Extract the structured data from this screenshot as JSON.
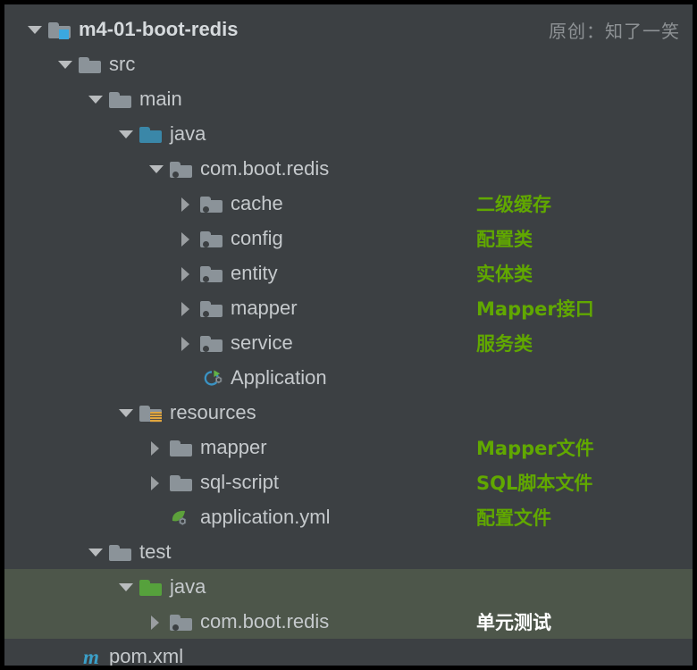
{
  "colors": {
    "background": "#3c4043",
    "frame": "#000000",
    "highlight_row": "#4d564a",
    "label_text": "#c5c9cc",
    "annotation_green": "#61a800",
    "annotation_white": "#ffffff",
    "watermark_text": "#8d9194",
    "folder_grey": "#8b9399",
    "folder_blue": "#3a87a8",
    "folder_green": "#56a13c",
    "module_badge_blue": "#3ba8e0",
    "resources_badge_orange": "#d79b3a",
    "maven_blue": "#3ba0c9"
  },
  "watermark": "原创：知了一笑",
  "tree": {
    "rows": [
      {
        "label": "m4-01-boot-redis",
        "indent": 0,
        "arrow": "down",
        "icon": "module-folder-icon",
        "bold": true,
        "highlight": false,
        "note": ""
      },
      {
        "label": "src",
        "indent": 1,
        "arrow": "down",
        "icon": "folder-icon",
        "bold": false,
        "highlight": false,
        "note": ""
      },
      {
        "label": "main",
        "indent": 2,
        "arrow": "down",
        "icon": "folder-icon",
        "bold": false,
        "highlight": false,
        "note": ""
      },
      {
        "label": "java",
        "indent": 3,
        "arrow": "down",
        "icon": "source-folder-icon",
        "bold": false,
        "highlight": false,
        "note": ""
      },
      {
        "label": "com.boot.redis",
        "indent": 4,
        "arrow": "down",
        "icon": "package-icon",
        "bold": false,
        "highlight": false,
        "note": ""
      },
      {
        "label": "cache",
        "indent": 5,
        "arrow": "right",
        "icon": "package-icon",
        "bold": false,
        "highlight": false,
        "note": "二级缓存"
      },
      {
        "label": "config",
        "indent": 5,
        "arrow": "right",
        "icon": "package-icon",
        "bold": false,
        "highlight": false,
        "note": "配置类"
      },
      {
        "label": "entity",
        "indent": 5,
        "arrow": "right",
        "icon": "package-icon",
        "bold": false,
        "highlight": false,
        "note": "实体类"
      },
      {
        "label": "mapper",
        "indent": 5,
        "arrow": "right",
        "icon": "package-icon",
        "bold": false,
        "highlight": false,
        "note": "Mapper接口"
      },
      {
        "label": "service",
        "indent": 5,
        "arrow": "right",
        "icon": "package-icon",
        "bold": false,
        "highlight": false,
        "note": "服务类"
      },
      {
        "label": "Application",
        "indent": 5,
        "arrow": "none",
        "icon": "spring-boot-run-icon",
        "bold": false,
        "highlight": false,
        "note": ""
      },
      {
        "label": "resources",
        "indent": 3,
        "arrow": "down",
        "icon": "resources-folder-icon",
        "bold": false,
        "highlight": false,
        "note": ""
      },
      {
        "label": "mapper",
        "indent": 4,
        "arrow": "right",
        "icon": "folder-icon",
        "bold": false,
        "highlight": false,
        "note": "Mapper文件"
      },
      {
        "label": "sql-script",
        "indent": 4,
        "arrow": "right",
        "icon": "folder-icon",
        "bold": false,
        "highlight": false,
        "note": "SQL脚本文件"
      },
      {
        "label": "application.yml",
        "indent": 4,
        "arrow": "none",
        "icon": "spring-yaml-icon",
        "bold": false,
        "highlight": false,
        "note": "配置文件"
      },
      {
        "label": "test",
        "indent": 2,
        "arrow": "down",
        "icon": "folder-icon",
        "bold": false,
        "highlight": false,
        "note": ""
      },
      {
        "label": "java",
        "indent": 3,
        "arrow": "down",
        "icon": "test-source-folder-icon",
        "bold": false,
        "highlight": true,
        "note": ""
      },
      {
        "label": "com.boot.redis",
        "indent": 4,
        "arrow": "right",
        "icon": "package-icon",
        "bold": false,
        "highlight": true,
        "note": "单元测试"
      },
      {
        "label": "pom.xml",
        "indent": 1,
        "arrow": "none",
        "icon": "maven-icon",
        "bold": false,
        "highlight": false,
        "note": ""
      }
    ]
  }
}
